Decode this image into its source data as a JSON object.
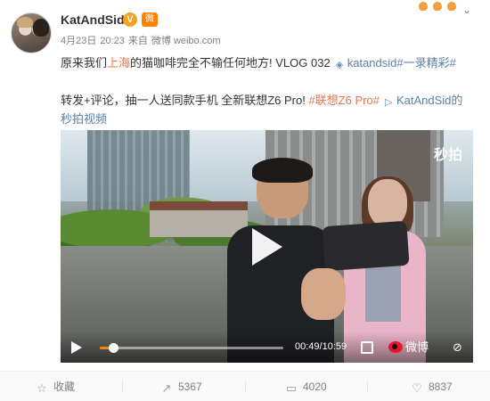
{
  "user": {
    "name": "KatAndSid",
    "verified_badge": "V",
    "vip_badge": "微"
  },
  "meta": {
    "date": "4月23日",
    "time": "20:23",
    "source_prefix": "来自",
    "source": "微博 weibo.com"
  },
  "content": {
    "line1_prefix": "原来我们",
    "line1_highlight": "上海",
    "line1_middle": "的猫咖啡完全不输任何地方! VLOG 032",
    "line1_link": "katandsid#一录精彩#",
    "line2_text": "转发+评论，抽一人送同款手机 全新联想Z6 Pro! ",
    "line2_hashtag": "#联想Z6 Pro#",
    "line2_link": "KatAndSid的",
    "line3_link": "秒拍视频"
  },
  "video": {
    "watermark": "秒拍",
    "time": "00:49/10:59",
    "progress": 0.075,
    "brand": "微博"
  },
  "actions": {
    "favorite": "收藏",
    "share": "5367",
    "comment": "4020",
    "like": "8837"
  },
  "colors": {
    "accent": "#eb7350",
    "link_blue": "#5a7fa8",
    "progress": "#ff8200"
  },
  "icons": [
    "verified-icon",
    "vip-icon",
    "chevron-down-icon",
    "pin-icon",
    "play-icon",
    "fullscreen-icon",
    "weibo-logo-icon",
    "mute-icon",
    "star-icon",
    "share-icon",
    "comment-icon",
    "like-icon"
  ]
}
